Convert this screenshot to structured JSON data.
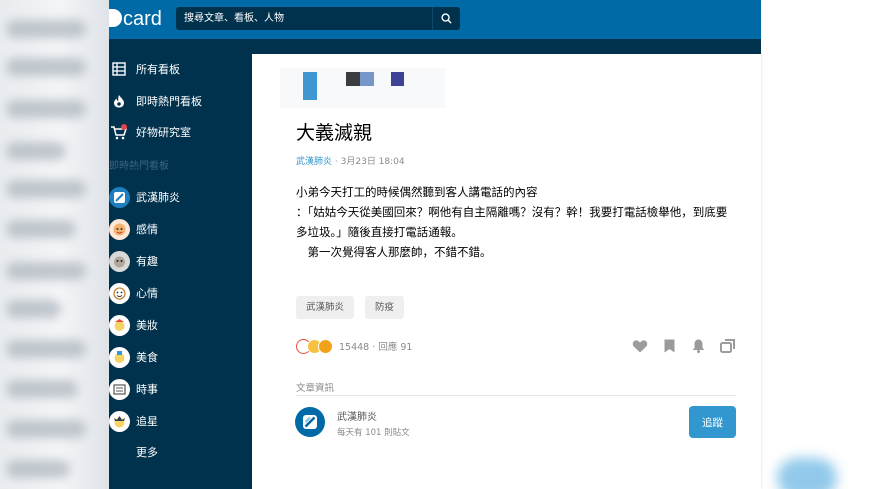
{
  "colors": {
    "brand": "#006aa6",
    "sidebar_bg": "#00324e",
    "accent": "#3397cf"
  },
  "header": {
    "logo_text": "card",
    "logo_icon": "dcard-d-icon",
    "search": {
      "placeholder": "搜尋文章、看板、人物",
      "icon": "search-icon"
    }
  },
  "sidebar": {
    "main_items": [
      {
        "label": "所有看板",
        "icon": "list-icon"
      },
      {
        "label": "即時熱門看板",
        "icon": "flame-icon"
      },
      {
        "label": "好物研究室",
        "icon": "cart-icon"
      }
    ],
    "section_title": "即時熱門看板",
    "boards": [
      {
        "label": "武漢肺炎",
        "icon": "wuhan-board-icon"
      },
      {
        "label": "感情",
        "icon": "relationship-board-icon"
      },
      {
        "label": "有趣",
        "icon": "funny-board-icon"
      },
      {
        "label": "心情",
        "icon": "mood-board-icon"
      },
      {
        "label": "美妝",
        "icon": "makeup-board-icon"
      },
      {
        "label": "美食",
        "icon": "food-board-icon"
      },
      {
        "label": "時事",
        "icon": "news-board-icon"
      },
      {
        "label": "追星",
        "icon": "idol-board-icon"
      }
    ],
    "more_label": "更多"
  },
  "post": {
    "title": "大義滅親",
    "board": "武漢肺炎",
    "separator": "·",
    "date": "3月23日 18:04",
    "body": "小弟今天打工的時候偶然聽到客人講電話的內容\n：「姑姑今天從美國回來？啊他有自主隔離嗎？沒有？幹！我要打電話檢舉他，到底要多垃圾。」隨後直接打電話通報。\n　第一次覺得客人那麼帥，不錯不錯。",
    "tags": [
      "武漢肺炎",
      "防疫"
    ],
    "reactions": [
      "heart-reaction-icon",
      "laugh-reaction-icon",
      "wow-reaction-icon"
    ],
    "like_count": "15448",
    "comment_label": "回應 91",
    "stats_separator": "·",
    "actions": [
      "heart-icon",
      "bookmark-icon",
      "bell-icon",
      "share-icon"
    ]
  },
  "info": {
    "title": "文章資訊",
    "board_name": "武漢肺炎",
    "board_sub": "每天有 101 則貼文",
    "follow_label": "追蹤"
  }
}
